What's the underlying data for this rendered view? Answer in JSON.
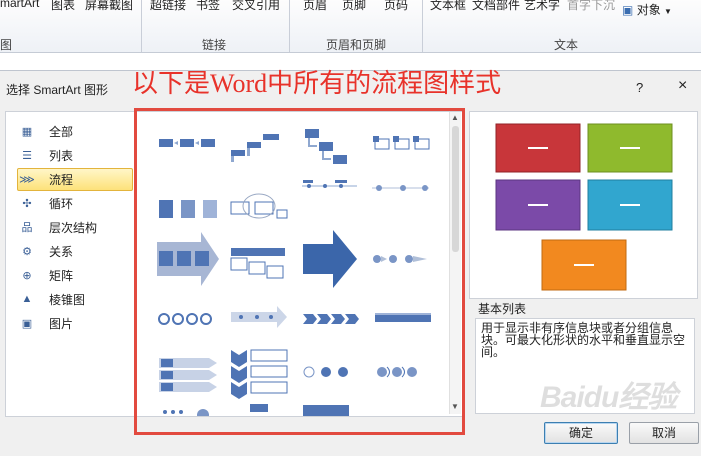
{
  "ribbon": {
    "top_items": [
      "martArt",
      "图表",
      "屏幕截图",
      "超链接",
      "书签",
      "交叉引用",
      "页眉",
      "页脚",
      "页码",
      "文本框",
      "文档部件",
      "艺术字",
      "首字下沉",
      "对象"
    ],
    "groups": [
      "图",
      "链接",
      "页眉和页脚",
      "文本"
    ]
  },
  "overlay_text": "以下是Word中所有的流程图样式",
  "dialog": {
    "title": "选择 SmartArt 图形",
    "help": "?",
    "close": "×",
    "categories": [
      {
        "label": "全部",
        "icon": "all-icon",
        "selected": false
      },
      {
        "label": "列表",
        "icon": "list-icon",
        "selected": false
      },
      {
        "label": "流程",
        "icon": "process-icon",
        "selected": true
      },
      {
        "label": "循环",
        "icon": "cycle-icon",
        "selected": false
      },
      {
        "label": "层次结构",
        "icon": "hierarchy-icon",
        "selected": false
      },
      {
        "label": "关系",
        "icon": "relationship-icon",
        "selected": false
      },
      {
        "label": "矩阵",
        "icon": "matrix-icon",
        "selected": false
      },
      {
        "label": "棱锥图",
        "icon": "pyramid-icon",
        "selected": false
      },
      {
        "label": "图片",
        "icon": "picture-icon",
        "selected": false
      }
    ],
    "preview_title": "基本列表",
    "description": "用于显示非有序信息块或者分组信息块。可最大化形状的水平和垂直显示空间。",
    "ok": "确定",
    "cancel": "取消"
  },
  "colors": {
    "accent_blue": "#4f74b4",
    "preview_shapes": [
      "#c8363a",
      "#8fba2d",
      "#7b4aa8",
      "#31a6cf",
      "#f2891f"
    ],
    "annotation_red": "#e24a3f"
  },
  "watermark": "Baidu经验"
}
